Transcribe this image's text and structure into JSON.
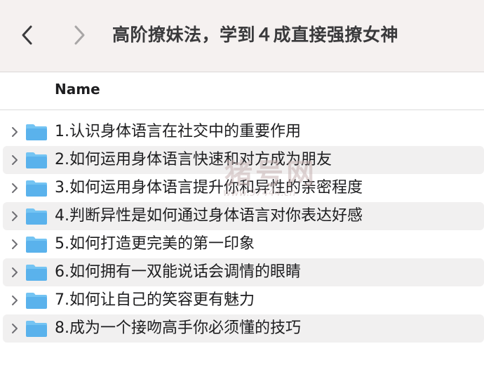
{
  "toolbar": {
    "title": "高阶撩妹法，学到４成直接强撩女神",
    "back_icon": "chevron-left-icon",
    "forward_icon": "chevron-right-icon"
  },
  "columns": {
    "name": "Name"
  },
  "items": [
    {
      "label": "1.认识身体语言在社交中的重要作用"
    },
    {
      "label": "2.如何运用身体语言快速和对方成为朋友"
    },
    {
      "label": "3.如何运用身体语言提升你和异性的亲密程度"
    },
    {
      "label": "4.判断异性是如何通过身体语言对你表达好感"
    },
    {
      "label": "5.如何打造更完美的第一印象"
    },
    {
      "label": "6.如何拥有一双能说话会调情的眼睛"
    },
    {
      "label": "7.如何让自己的笑容更有魅力"
    },
    {
      "label": "8.成为一个接吻高手你必须懂的技巧"
    }
  ],
  "watermark": {
    "text": "猪号网",
    "url": "www.97444.cn"
  },
  "colors": {
    "folder": "#5ab2ec",
    "folder_tab": "#74c4f3",
    "toolbar_bg": "#f5f1f0",
    "alt_row_bg": "#f1f0f0"
  }
}
